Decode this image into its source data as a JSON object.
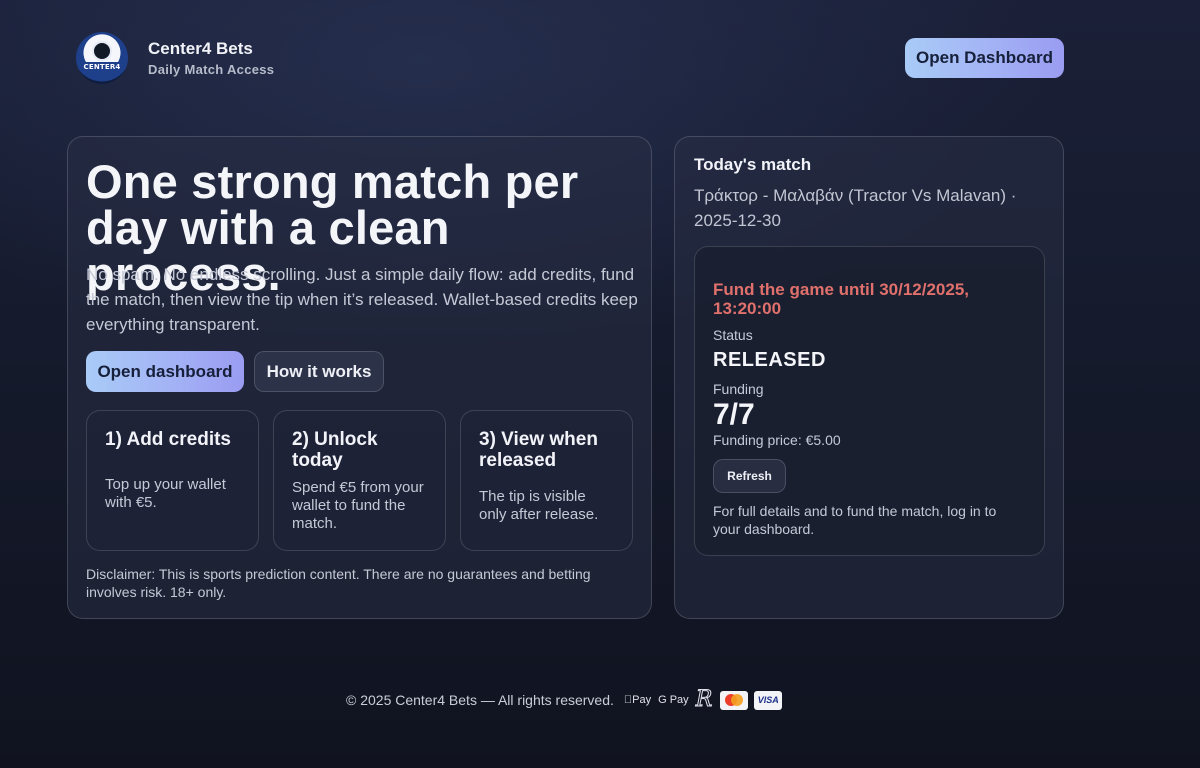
{
  "header": {
    "brand_name": "Center4 Bets",
    "brand_sub": "Daily Match Access",
    "logo_text": "CENTER4",
    "open_dashboard": "Open Dashboard"
  },
  "hero": {
    "title": "One strong match per day with a clean process.",
    "description": "No spam. No endless scrolling. Just a simple daily flow: add credits, fund the match, then view the tip when it’s released. Wallet-based credits keep everything transparent.",
    "open_dashboard": "Open dashboard",
    "how_it_works": "How it works",
    "steps": [
      {
        "title": "1) Add credits",
        "desc": "Top up your wallet with €5."
      },
      {
        "title": "2) Unlock today",
        "desc": "Spend €5 from your wallet to fund the match."
      },
      {
        "title": "3) View when released",
        "desc": "The tip is visible only after release."
      }
    ],
    "disclaimer": "Disclaimer: This is sports prediction content. There are no guarantees and betting involves risk. 18+ only."
  },
  "match": {
    "label": "Today's match",
    "name": "Τράκτορ - Μαλαβάν (Tractor Vs Malavan) · 2025-12-30",
    "fund_until": "Fund the game until 30/12/2025, 13:20:00",
    "status_label": "Status",
    "status_value": "RELEASED",
    "funding_label": "Funding",
    "funding_value": "7/7",
    "funding_price": "Funding price: €5.00",
    "refresh": "Refresh",
    "details": "For full details and to fund the match, log in to your dashboard."
  },
  "footer": {
    "copyright": "© 2025 Center4 Bets — All rights reserved.",
    "apple_pay": "Pay",
    "google_pay": "G Pay",
    "revolut": "R",
    "visa": "VISA"
  },
  "colors": {
    "accent_gradient_start": "#a9cbf7",
    "accent_gradient_end": "#9a9cf1",
    "fund_until": "#e0706b",
    "background": "#151a2c"
  }
}
